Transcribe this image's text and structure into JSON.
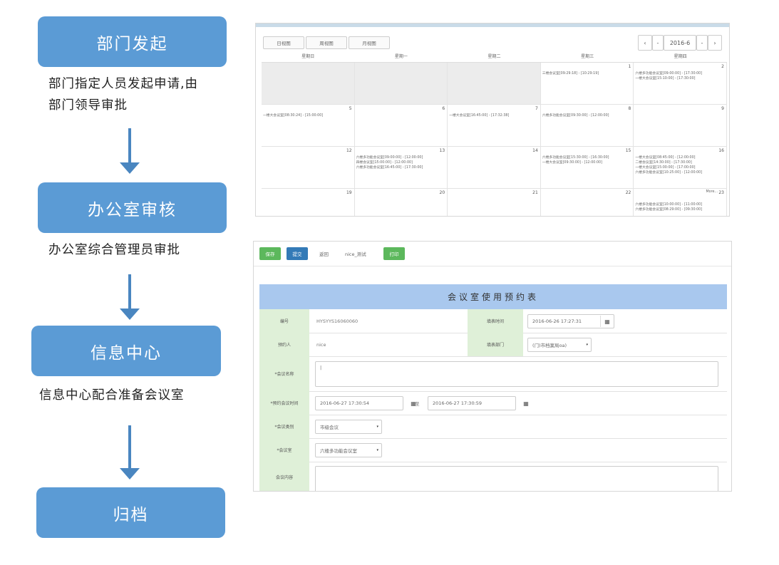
{
  "steps": [
    {
      "label": "部门发起",
      "desc": [
        "部门指定人员发起申请,由",
        "部门领导审批"
      ]
    },
    {
      "label": "办公室审核",
      "desc": [
        "办公室综合管理员审批"
      ]
    },
    {
      "label": "信息中心",
      "desc": [
        "信息中心配合准备会议室"
      ]
    },
    {
      "label": "归档"
    }
  ],
  "calendar": {
    "views": [
      "日视图",
      "周视图",
      "月视图"
    ],
    "nav": {
      "prev": "‹",
      "prev2": "-",
      "month": "2016-6",
      "next2": "-",
      "next": "›"
    },
    "weekdays": [
      "星期日",
      "星期一",
      "星期二",
      "星期三",
      "星期四"
    ],
    "weeks": [
      {
        "days": [
          "",
          "",
          "",
          "1",
          "2"
        ],
        "events": [
          [],
          [],
          [],
          [
            "三楼会议室[09:29:18] - [10:29:19]"
          ],
          [
            "六楼多功能会议室[09:00:00] - [17:30:00]",
            "一楼大会议室[15:10:00] - [17:30:00]"
          ]
        ]
      },
      {
        "days": [
          "5",
          "6",
          "7",
          "8",
          "9"
        ],
        "events": [
          [
            "一楼大会议室[08:30:24] - [15:00:00]"
          ],
          [],
          [
            "一楼大会议室[16:45:00] - [17:32:38]"
          ],
          [
            "六楼多功能会议室[09:30:00] - [12:00:00]"
          ],
          []
        ]
      },
      {
        "days": [
          "12",
          "13",
          "14",
          "15",
          "16"
        ],
        "events": [
          [],
          [
            "六楼多功能会议室[09:00:00] - [12:00:00]",
            "四楼会议室[15:00:00] - [12:00:00]",
            "六楼多功能会议室[16:45:00] - [17:30:00]"
          ],
          [],
          [
            "六楼多功能会议室[15:30:00] - [16:30:00]",
            "一楼大会议室[09:30:00] - [12:00:00]"
          ],
          [
            "一楼大会议室[08:45:00] - [12:00:00]",
            "二楼会议室[14:30:00] - [17:30:00]",
            "一楼大会议室[15:00:00] - [17:00:00]",
            "六楼多功能会议室[10:25:00] - [12:00:00]"
          ]
        ]
      },
      {
        "days": [
          "19",
          "20",
          "21",
          "22",
          "23"
        ],
        "events": [
          [],
          [],
          [],
          [],
          [
            "More...",
            "六楼多功能会议室[10:00:00] - [11:00:00]",
            "六楼多功能会议室[08:29:00] - [09:30:00]"
          ]
        ]
      }
    ]
  },
  "form": {
    "toolbar": {
      "save": "保存",
      "submit": "提交",
      "back": "返回",
      "user": "nice_测试",
      "print": "打印"
    },
    "title": "会议室使用预约表",
    "fields": {
      "number_label": "编号",
      "number_value": "HYSYYS16060060",
      "fill_time_label": "填表时间",
      "fill_time_value": "2016-06-26 17:27:31",
      "booker_label": "预约人",
      "booker_value": "nice",
      "dept_label": "填表部门",
      "dept_value": "(门)市档案局oa)",
      "name_label": "*会议名称",
      "name_value": "|",
      "time_label": "*预约会议时间",
      "time_start": "2016-06-27 17:30:54",
      "time_to": "至",
      "time_end": "2016-06-27 17:30:59",
      "type_label": "*会议类别",
      "type_value": "市级会议",
      "room_label": "*会议室",
      "room_value": "六楼多功能会议室",
      "content_label": "会议内容"
    },
    "calendar_icon": "▦",
    "select_icon": "▾"
  }
}
